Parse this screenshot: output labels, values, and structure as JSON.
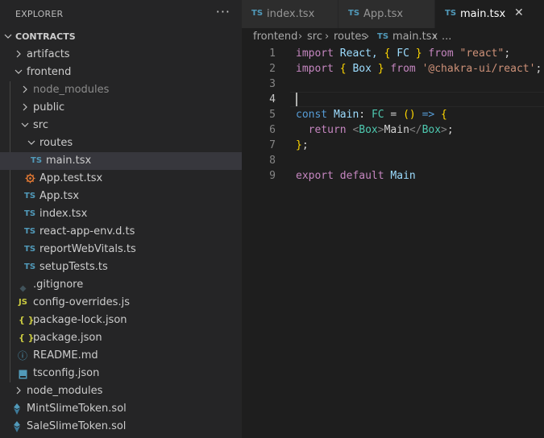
{
  "explorer": {
    "title": "EXPLORER",
    "more": "···",
    "root": "CONTRACTS",
    "items": [
      {
        "label": "artifacts"
      },
      {
        "label": "frontend"
      },
      {
        "label": "node_modules"
      },
      {
        "label": "public"
      },
      {
        "label": "src"
      },
      {
        "label": "routes"
      },
      {
        "label": "main.tsx",
        "icon": "TS"
      },
      {
        "label": "App.test.tsx"
      },
      {
        "label": "App.tsx",
        "icon": "TS"
      },
      {
        "label": "index.tsx",
        "icon": "TS"
      },
      {
        "label": "react-app-env.d.ts",
        "icon": "TS"
      },
      {
        "label": "reportWebVitals.ts",
        "icon": "TS"
      },
      {
        "label": "setupTests.ts",
        "icon": "TS"
      },
      {
        "label": ".gitignore"
      },
      {
        "label": "config-overrides.js",
        "icon": "JS"
      },
      {
        "label": "package-lock.json",
        "icon": "{ }"
      },
      {
        "label": "package.json",
        "icon": "{ }"
      },
      {
        "label": "README.md",
        "icon": "ⓘ"
      },
      {
        "label": "tsconfig.json"
      },
      {
        "label": "node_modules"
      },
      {
        "label": "MintSlimeToken.sol"
      },
      {
        "label": "SaleSlimeToken.sol"
      }
    ]
  },
  "tabs": [
    {
      "icon": "TS",
      "label": "index.tsx"
    },
    {
      "icon": "TS",
      "label": "App.tsx"
    },
    {
      "icon": "TS",
      "label": "main.tsx",
      "close": "✕"
    }
  ],
  "breadcrumb": {
    "parts": [
      "frontend",
      "src",
      "routes"
    ],
    "file_icon": "TS",
    "file": "main.tsx",
    "tail": "...",
    "sep": "›"
  },
  "editor": {
    "line_numbers": [
      "1",
      "2",
      "3",
      "4",
      "5",
      "6",
      "7",
      "8",
      "9"
    ],
    "lines": {
      "l1": {
        "a": "import",
        "b": "React,",
        "c": "{",
        "d": "FC",
        "e": "}",
        "f": "from",
        "g": "\"react\"",
        "h": ";"
      },
      "l2": {
        "a": "import",
        "b": "{",
        "c": "Box",
        "d": "}",
        "e": "from",
        "f": "'@chakra-ui/react'",
        "g": ";"
      },
      "l5": {
        "a": "const",
        "b": "Main",
        "c": ":",
        "d": "FC",
        "e": "=",
        "f": "()",
        "g": "=>",
        "h": "{"
      },
      "l6": {
        "a": "return",
        "b": "<",
        "c": "Box",
        "d": ">",
        "e": "Main",
        "f": "</",
        "g": "Box",
        "h": ">",
        "i": ";"
      },
      "l7": {
        "a": "}",
        "b": ";"
      },
      "l9": {
        "a": "export",
        "b": "default",
        "c": "Main"
      }
    }
  },
  "colors": {
    "ts_icon": "#519aba",
    "js_icon": "#cbcb41",
    "json_icon": "#cbcb41",
    "sol_icon": "#519aba",
    "accent": "#37373d"
  }
}
